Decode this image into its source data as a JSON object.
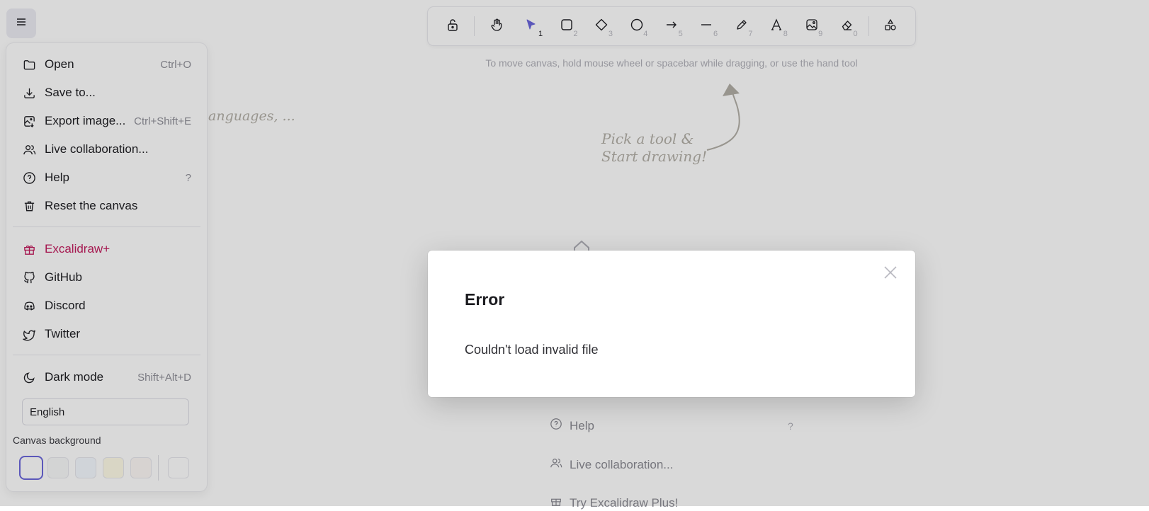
{
  "toolbar": {
    "tools": [
      {
        "name": "lock",
        "num": ""
      },
      {
        "name": "hand",
        "num": ""
      },
      {
        "name": "selection",
        "num": "1"
      },
      {
        "name": "rectangle",
        "num": "2"
      },
      {
        "name": "diamond",
        "num": "3"
      },
      {
        "name": "ellipse",
        "num": "4"
      },
      {
        "name": "arrow",
        "num": "5"
      },
      {
        "name": "line",
        "num": "6"
      },
      {
        "name": "draw",
        "num": "7"
      },
      {
        "name": "text",
        "num": "8"
      },
      {
        "name": "image",
        "num": "9"
      },
      {
        "name": "eraser",
        "num": "0"
      },
      {
        "name": "shapes-library",
        "num": ""
      }
    ],
    "hint": "To move canvas, hold mouse wheel or spacebar while dragging, or use the hand tool"
  },
  "canvas_hints": {
    "pick_tool_line1": "Pick a tool &",
    "pick_tool_line2": "Start drawing!",
    "languages_fragment": "anguages, ..."
  },
  "welcome": {
    "help_label": "Help",
    "help_shortcut": "?",
    "live_collab_label": "Live collaboration...",
    "try_plus_label": "Try Excalidraw Plus!"
  },
  "menu": {
    "open": {
      "label": "Open",
      "shortcut": "Ctrl+O"
    },
    "save": {
      "label": "Save to..."
    },
    "export": {
      "label": "Export image...",
      "shortcut": "Ctrl+Shift+E"
    },
    "live": {
      "label": "Live collaboration..."
    },
    "help": {
      "label": "Help",
      "shortcut": "?"
    },
    "reset": {
      "label": "Reset the canvas"
    },
    "plus": {
      "label": "Excalidraw+"
    },
    "github": {
      "label": "GitHub"
    },
    "discord": {
      "label": "Discord"
    },
    "twitter": {
      "label": "Twitter"
    },
    "dark": {
      "label": "Dark mode",
      "shortcut": "Shift+Alt+D"
    },
    "language": "English",
    "canvas_bg_label": "Canvas background",
    "swatches": [
      "#ffffff",
      "#f8f9fa",
      "#f5faff",
      "#fffce8",
      "#fdf8f6",
      "#ffffff"
    ],
    "plus_color": "#c2185b"
  },
  "modal": {
    "title": "Error",
    "message": "Couldn't load invalid file"
  },
  "colors": {
    "accent": "#6965db"
  }
}
